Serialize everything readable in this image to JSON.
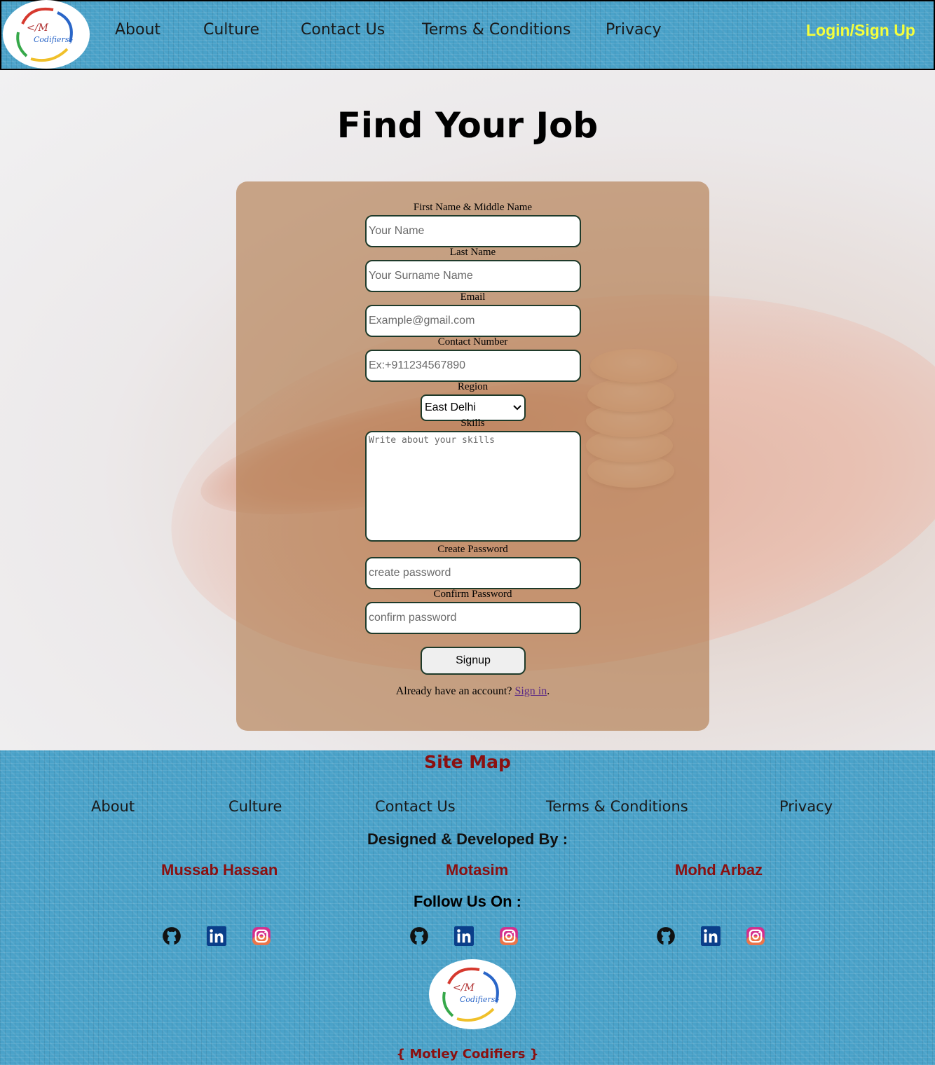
{
  "header": {
    "logo_text": "IM Codifiers",
    "nav": [
      "About",
      "Culture",
      "Contact Us",
      "Terms & Conditions",
      "Privacy"
    ],
    "login": "Login/Sign Up"
  },
  "hero": {
    "title": "Find Your Job"
  },
  "form": {
    "first_name_label": "First Name & Middle Name",
    "first_name_placeholder": "Your Name",
    "last_name_label": "Last Name",
    "last_name_placeholder": "Your Surname Name",
    "email_label": "Email",
    "email_placeholder": "Example@gmail.com",
    "contact_label": "Contact Number",
    "contact_placeholder": "Ex:+911234567890",
    "region_label": "Region",
    "region_value": "East Delhi",
    "skills_label": "Skills",
    "skills_placeholder": "Write about your skills",
    "create_password_label": "Create Password",
    "create_password_placeholder": "create password",
    "confirm_password_label": "Confirm Password",
    "confirm_password_placeholder": "confirm password",
    "signup_button": "Signup",
    "already_text": "Already have an account?",
    "signin_link": "Sign in",
    "period": "."
  },
  "footer": {
    "site_map_title": "Site Map",
    "links": [
      "About",
      "Culture",
      "Contact Us",
      "Terms & Conditions",
      "Privacy"
    ],
    "designed_by": "Designed & Developed By :",
    "developers": [
      "Mussab Hassan",
      "Motasim",
      "Mohd Arbaz"
    ],
    "follow_us": "Follow Us On :",
    "social_icons": [
      "github-icon",
      "linkedin-icon",
      "instagram-icon"
    ],
    "brand": "{ Motley Codifiers }"
  },
  "colors": {
    "header_blue": "#4aa2c9",
    "login_yellow": "#f5ff3c",
    "footer_red": "#8a1010",
    "card_brown": "#b07848",
    "link_purple": "#5b2a86"
  }
}
